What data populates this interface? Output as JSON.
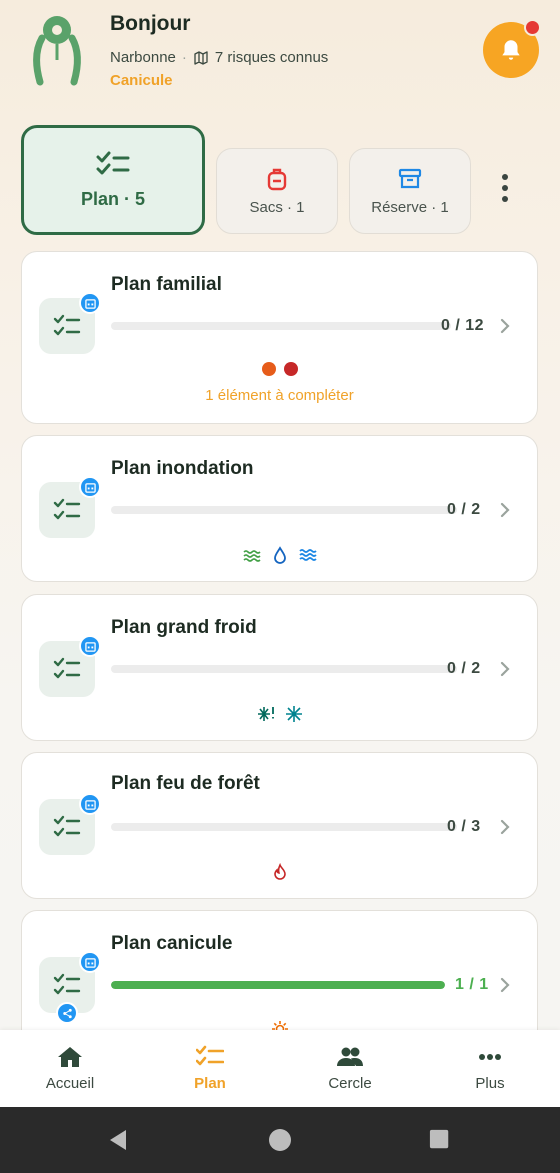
{
  "header": {
    "greeting": "Bonjour",
    "city": "Narbonne",
    "separator": "·",
    "risks": "7 risques connus",
    "active_risk": "Canicule",
    "map_icon": "map-icon",
    "notification_icon": "bell-icon"
  },
  "tabs": [
    {
      "label": "Plan · 5",
      "icon": "checklist-icon",
      "active": true
    },
    {
      "label": "Sacs · 1",
      "icon": "backpack-icon",
      "active": false
    },
    {
      "label": "Réserve · 1",
      "icon": "archive-box-icon",
      "active": false
    }
  ],
  "plans": [
    {
      "title": "Plan familial",
      "count": "0 / 12",
      "progress": 0,
      "note": "1 élément à compléter",
      "risk_icons": [
        "orange-dot",
        "red-dot"
      ]
    },
    {
      "title": "Plan inondation",
      "count": "0 / 2",
      "progress": 0,
      "risk_icons": [
        "waves-icon",
        "water-drop-icon",
        "flood-icon"
      ]
    },
    {
      "title": "Plan grand froid",
      "count": "0 / 2",
      "progress": 0,
      "risk_icons": [
        "snowflake-alert-icon",
        "snowflake-icon"
      ]
    },
    {
      "title": "Plan feu de forêt",
      "count": "0 / 3",
      "progress": 0,
      "risk_icons": [
        "fire-icon"
      ]
    },
    {
      "title": "Plan canicule",
      "count": "1 / 1",
      "progress": 1,
      "shared": true,
      "risk_icons": [
        "sun-icon"
      ]
    }
  ],
  "nav": [
    {
      "label": "Accueil",
      "icon": "home-icon",
      "active": false
    },
    {
      "label": "Plan",
      "icon": "checklist-icon",
      "active": true
    },
    {
      "label": "Cercle",
      "icon": "group-icon",
      "active": false
    },
    {
      "label": "Plus",
      "icon": "more-horiz-icon",
      "active": false
    }
  ],
  "colors": {
    "accent": "#f7a523",
    "brand_green": "#2f6b45",
    "progress_green": "#4caf50",
    "badge_blue": "#2196f3"
  }
}
